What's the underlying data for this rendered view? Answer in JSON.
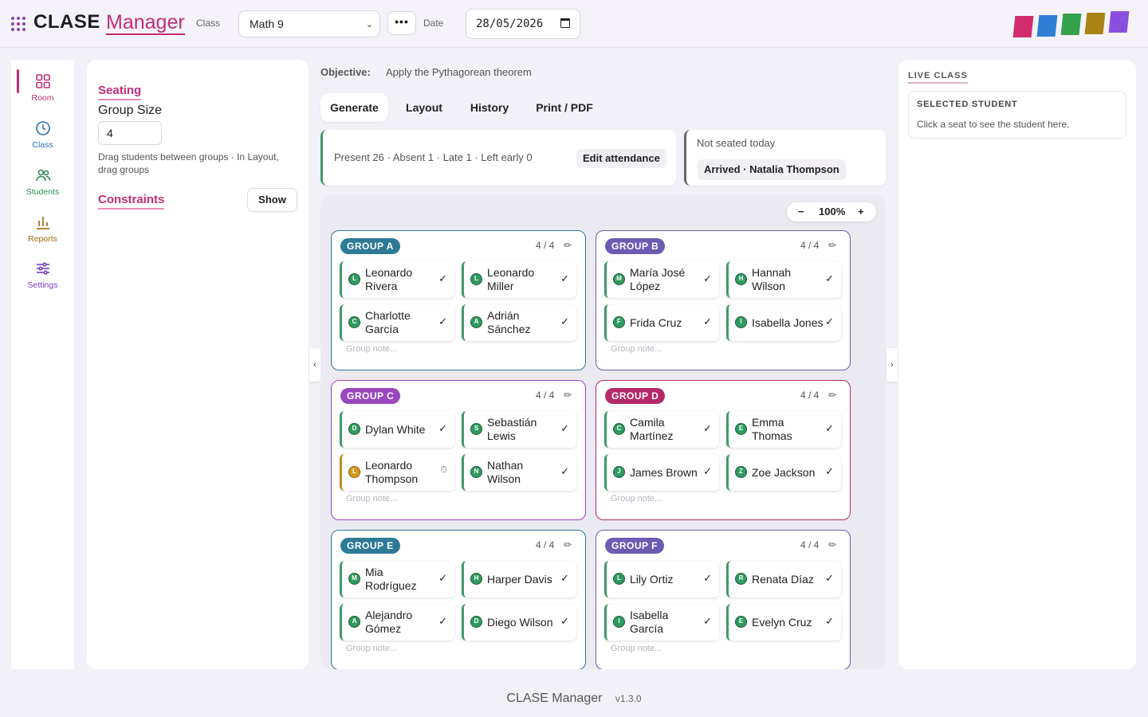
{
  "header": {
    "logo_primary": "CLASE",
    "logo_secondary": "Manager",
    "class_label": "Class",
    "class_value": "Math 9",
    "more_label": "•••",
    "date_label": "Date",
    "date_value": "28/05/2026",
    "swatch_colors": [
      "#d22c6c",
      "#2f7fd6",
      "#35a24d",
      "#a98316",
      "#8a4fe0"
    ]
  },
  "nav": {
    "items": [
      {
        "label": "Room",
        "icon": "grid-icon",
        "color": "#c22d78"
      },
      {
        "label": "Class",
        "icon": "clock-icon",
        "color": "#2c6fb3"
      },
      {
        "label": "Students",
        "icon": "people-icon",
        "color": "#2f8a54"
      },
      {
        "label": "Reports",
        "icon": "bar-chart-icon",
        "color": "#9a6a10"
      },
      {
        "label": "Settings",
        "icon": "sliders-icon",
        "color": "#7a3fc0"
      }
    ]
  },
  "seating": {
    "title": "Seating",
    "group_size_label": "Group Size",
    "group_size_value": "4",
    "help": "Drag students between groups · In Layout, drag groups",
    "constraints_label": "Constraints",
    "show_label": "Show"
  },
  "main": {
    "objective_label": "Objective:",
    "objective_value": "Apply the Pythagorean theorem",
    "tabs": [
      "Generate",
      "Layout",
      "History",
      "Print / PDF"
    ],
    "attendance_summary": "Present 26 · Absent 1 · Late 1 · Left early 0",
    "edit_attendance_label": "Edit attendance",
    "not_seated_title": "Not seated today",
    "not_seated_chip": "Arrived · Natalia Thompson",
    "zoom_minus": "−",
    "zoom_value": "100%",
    "zoom_plus": "+",
    "group_note_placeholder": "Group note...",
    "groups": [
      {
        "name": "GROUP A",
        "count": "4 / 4",
        "color": "#2e7a96",
        "students": [
          {
            "initial": "L",
            "name": "Leonardo Rivera",
            "mark": "✓",
            "late": false
          },
          {
            "initial": "L",
            "name": "Leonardo Miller",
            "mark": "✓",
            "late": false
          },
          {
            "initial": "C",
            "name": "Charlotte García",
            "mark": "✓",
            "late": false
          },
          {
            "initial": "A",
            "name": "Adrián Sánchez",
            "mark": "✓",
            "late": false
          }
        ]
      },
      {
        "name": "GROUP B",
        "count": "4 / 4",
        "color": "#6d5bb2",
        "students": [
          {
            "initial": "M",
            "name": "María José López",
            "mark": "✓",
            "late": false
          },
          {
            "initial": "H",
            "name": "Hannah Wilson",
            "mark": "✓",
            "late": false
          },
          {
            "initial": "F",
            "name": "Frida Cruz",
            "mark": "✓",
            "late": false
          },
          {
            "initial": "I",
            "name": "Isabella Jones",
            "mark": "✓",
            "late": false
          }
        ]
      },
      {
        "name": "GROUP C",
        "count": "4 / 4",
        "color": "#9b48c0",
        "students": [
          {
            "initial": "D",
            "name": "Dylan White",
            "mark": "✓",
            "late": false
          },
          {
            "initial": "S",
            "name": "Sebastián Lewis",
            "mark": "✓",
            "late": false
          },
          {
            "initial": "L",
            "name": "Leonardo Thompson",
            "mark": "⏱",
            "late": true
          },
          {
            "initial": "N",
            "name": "Nathan Wilson",
            "mark": "✓",
            "late": false
          }
        ]
      },
      {
        "name": "GROUP D",
        "count": "4 / 4",
        "color": "#b52a67",
        "students": [
          {
            "initial": "C",
            "name": "Camila Martínez",
            "mark": "✓",
            "late": false
          },
          {
            "initial": "E",
            "name": "Emma Thomas",
            "mark": "✓",
            "late": false
          },
          {
            "initial": "J",
            "name": "James Brown",
            "mark": "✓",
            "late": false
          },
          {
            "initial": "Z",
            "name": "Zoe Jackson",
            "mark": "✓",
            "late": false
          }
        ]
      },
      {
        "name": "GROUP E",
        "count": "4 / 4",
        "color": "#2e7a96",
        "students": [
          {
            "initial": "M",
            "name": "Mia Rodríguez",
            "mark": "✓",
            "late": false
          },
          {
            "initial": "H",
            "name": "Harper Davis",
            "mark": "✓",
            "late": false
          },
          {
            "initial": "A",
            "name": "Alejandro Gómez",
            "mark": "✓",
            "late": false
          },
          {
            "initial": "D",
            "name": "Diego Wilson",
            "mark": "✓",
            "late": false
          }
        ]
      },
      {
        "name": "GROUP F",
        "count": "4 / 4",
        "color": "#6d5bb2",
        "students": [
          {
            "initial": "L",
            "name": "Lily Ortiz",
            "mark": "✓",
            "late": false
          },
          {
            "initial": "R",
            "name": "Renata Díaz",
            "mark": "✓",
            "late": false
          },
          {
            "initial": "I",
            "name": "Isabella García",
            "mark": "✓",
            "late": false
          },
          {
            "initial": "E",
            "name": "Evelyn Cruz",
            "mark": "✓",
            "late": false
          }
        ]
      }
    ]
  },
  "live": {
    "title": "LIVE CLASS",
    "selected_title": "SELECTED STUDENT",
    "selected_text": "Click a seat to see the student here."
  },
  "footer": {
    "app_name": "CLASE Manager",
    "version": "v1.3.0"
  }
}
